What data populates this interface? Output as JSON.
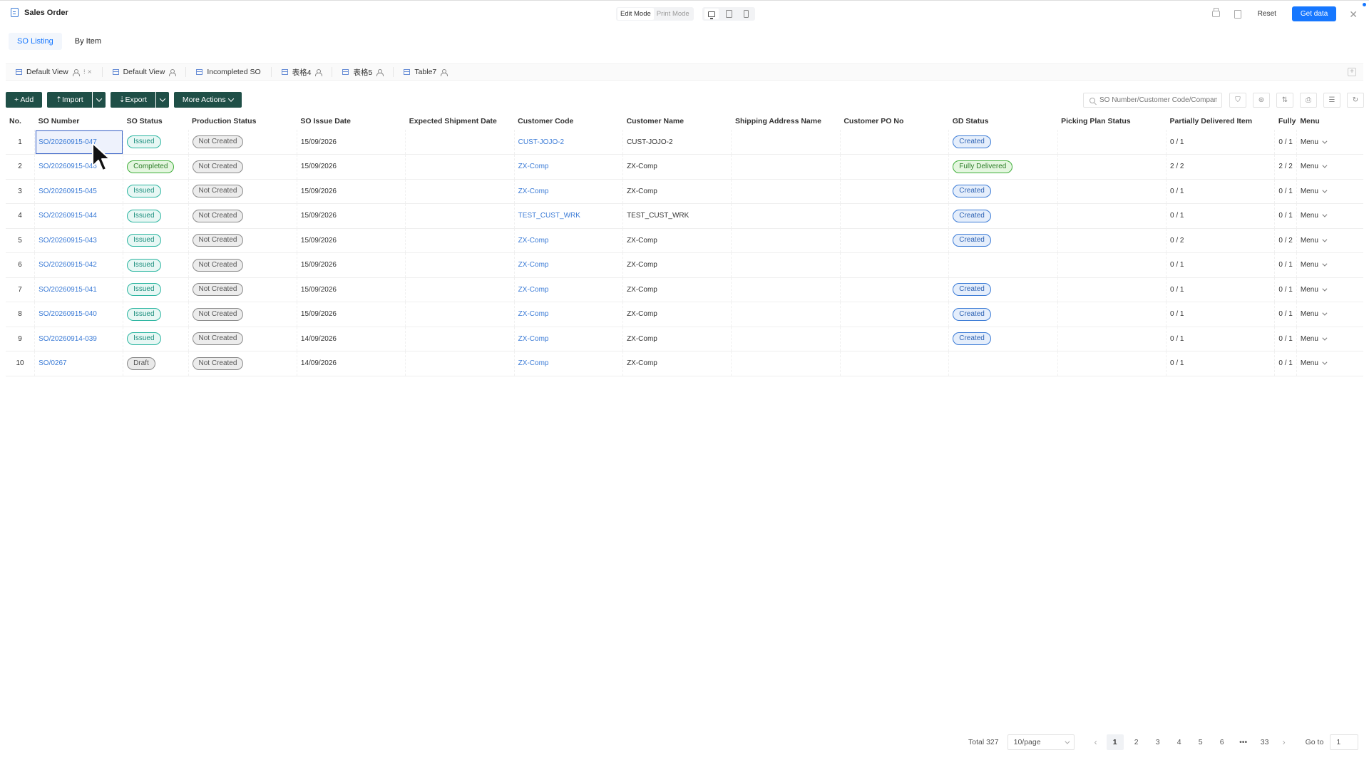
{
  "header": {
    "title": "Sales Order",
    "edit_mode": "Edit Mode",
    "print_mode": "Print Mode",
    "reset": "Reset",
    "get_data": "Get data",
    "close": "✕"
  },
  "top_tabs": [
    {
      "label": "SO Listing",
      "active": true
    },
    {
      "label": "By Item",
      "active": false
    }
  ],
  "view_tabs": [
    {
      "label": "Default View",
      "extra": "⁝ ×"
    },
    {
      "label": "Default View"
    },
    {
      "label": "Incompleted SO"
    },
    {
      "label": "表格4"
    },
    {
      "label": "表格5"
    },
    {
      "label": "Table7"
    }
  ],
  "view_add": "+",
  "toolbar": {
    "add": "+ Add",
    "import": "⇡Import",
    "export": "⇣Export",
    "more_actions": "More Actions",
    "search_placeholder": "SO Number/Customer Code/Company"
  },
  "table": {
    "columns": [
      "No.",
      "SO Number",
      "SO Status",
      "Production Status",
      "SO Issue Date",
      "Expected Shipment Date",
      "Customer Code",
      "Customer Name",
      "Shipping Address Name",
      "Customer PO No",
      "GD Status",
      "Picking Plan Status",
      "Partially Delivered Item",
      "Fully",
      "Menu"
    ],
    "rows": [
      {
        "no": "1",
        "so_number": "SO/20260915-047",
        "so_status": "Issued",
        "production_status": "Not Created",
        "issue_date": "15/09/2026",
        "shipment_date": "",
        "customer_code": "CUST-JOJO-2",
        "customer_name": "CUST-JOJO-2",
        "shipping_address": "",
        "po_no": "",
        "gd_status": "Created",
        "picking_status": "",
        "partial": "0 / 1",
        "fully": "0 / 1",
        "menu": "Menu"
      },
      {
        "no": "2",
        "so_number": "SO/20260915-046",
        "so_status": "Completed",
        "production_status": "Not Created",
        "issue_date": "15/09/2026",
        "shipment_date": "",
        "customer_code": "ZX-Comp",
        "customer_name": "ZX-Comp",
        "shipping_address": "",
        "po_no": "",
        "gd_status": "Fully Delivered",
        "picking_status": "",
        "partial": "2 / 2",
        "fully": "2 / 2",
        "menu": "Menu"
      },
      {
        "no": "3",
        "so_number": "SO/20260915-045",
        "so_status": "Issued",
        "production_status": "Not Created",
        "issue_date": "15/09/2026",
        "shipment_date": "",
        "customer_code": "ZX-Comp",
        "customer_name": "ZX-Comp",
        "shipping_address": "",
        "po_no": "",
        "gd_status": "Created",
        "picking_status": "",
        "partial": "0 / 1",
        "fully": "0 / 1",
        "menu": "Menu"
      },
      {
        "no": "4",
        "so_number": "SO/20260915-044",
        "so_status": "Issued",
        "production_status": "Not Created",
        "issue_date": "15/09/2026",
        "shipment_date": "",
        "customer_code": "TEST_CUST_WRK",
        "customer_name": "TEST_CUST_WRK",
        "shipping_address": "",
        "po_no": "",
        "gd_status": "Created",
        "picking_status": "",
        "partial": "0 / 1",
        "fully": "0 / 1",
        "menu": "Menu"
      },
      {
        "no": "5",
        "so_number": "SO/20260915-043",
        "so_status": "Issued",
        "production_status": "Not Created",
        "issue_date": "15/09/2026",
        "shipment_date": "",
        "customer_code": "ZX-Comp",
        "customer_name": "ZX-Comp",
        "shipping_address": "",
        "po_no": "",
        "gd_status": "Created",
        "picking_status": "",
        "partial": "0 / 2",
        "fully": "0 / 2",
        "menu": "Menu"
      },
      {
        "no": "6",
        "so_number": "SO/20260915-042",
        "so_status": "Issued",
        "production_status": "Not Created",
        "issue_date": "15/09/2026",
        "shipment_date": "",
        "customer_code": "ZX-Comp",
        "customer_name": "ZX-Comp",
        "shipping_address": "",
        "po_no": "",
        "gd_status": "",
        "picking_status": "",
        "partial": "0 / 1",
        "fully": "0 / 1",
        "menu": "Menu"
      },
      {
        "no": "7",
        "so_number": "SO/20260915-041",
        "so_status": "Issued",
        "production_status": "Not Created",
        "issue_date": "15/09/2026",
        "shipment_date": "",
        "customer_code": "ZX-Comp",
        "customer_name": "ZX-Comp",
        "shipping_address": "",
        "po_no": "",
        "gd_status": "Created",
        "picking_status": "",
        "partial": "0 / 1",
        "fully": "0 / 1",
        "menu": "Menu"
      },
      {
        "no": "8",
        "so_number": "SO/20260915-040",
        "so_status": "Issued",
        "production_status": "Not Created",
        "issue_date": "15/09/2026",
        "shipment_date": "",
        "customer_code": "ZX-Comp",
        "customer_name": "ZX-Comp",
        "shipping_address": "",
        "po_no": "",
        "gd_status": "Created",
        "picking_status": "",
        "partial": "0 / 1",
        "fully": "0 / 1",
        "menu": "Menu"
      },
      {
        "no": "9",
        "so_number": "SO/20260914-039",
        "so_status": "Issued",
        "production_status": "Not Created",
        "issue_date": "14/09/2026",
        "shipment_date": "",
        "customer_code": "ZX-Comp",
        "customer_name": "ZX-Comp",
        "shipping_address": "",
        "po_no": "",
        "gd_status": "Created",
        "picking_status": "",
        "partial": "0 / 1",
        "fully": "0 / 1",
        "menu": "Menu"
      },
      {
        "no": "10",
        "so_number": "SO/0267",
        "so_status": "Draft",
        "production_status": "Not Created",
        "issue_date": "14/09/2026",
        "shipment_date": "",
        "customer_code": "ZX-Comp",
        "customer_name": "ZX-Comp",
        "shipping_address": "",
        "po_no": "",
        "gd_status": "",
        "picking_status": "",
        "partial": "0 / 1",
        "fully": "0 / 1",
        "menu": "Menu"
      }
    ]
  },
  "pagination": {
    "total": "Total 327",
    "page_size": "10/page",
    "pages": [
      "1",
      "2",
      "3",
      "4",
      "5",
      "6",
      "•••",
      "33"
    ],
    "current": "1",
    "goto_label": "Go to",
    "goto_value": "1",
    "prev": "‹",
    "next": "›"
  },
  "colors": {
    "primary": "#1677ff",
    "toolbar_button": "#1f4f47",
    "link": "#3b7bd6",
    "issued": "#2ab5a0",
    "completed": "#3fae3a",
    "created": "#3b7bd6",
    "neutral": "#8a8a8a"
  }
}
